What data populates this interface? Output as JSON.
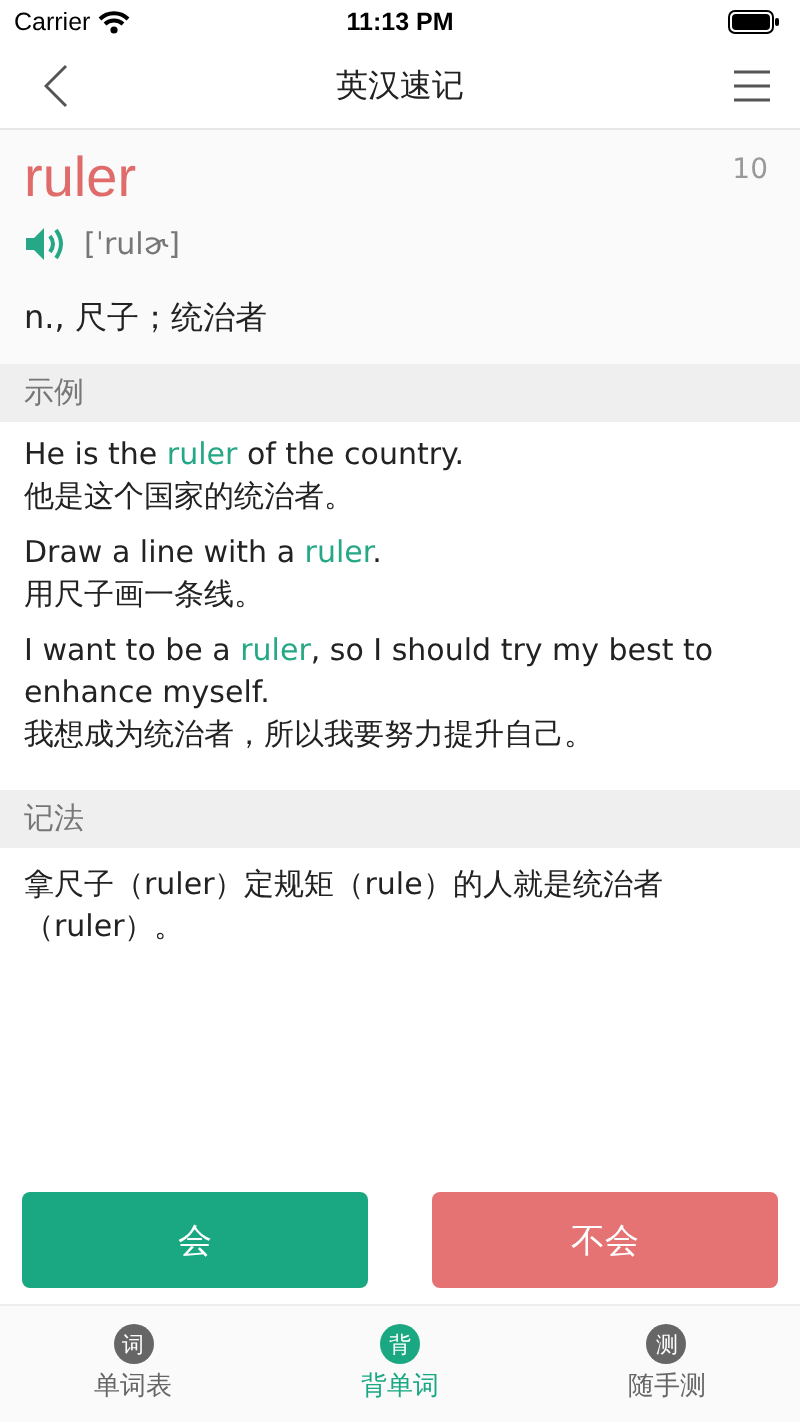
{
  "status_bar": {
    "carrier": "Carrier",
    "time": "11:13 PM"
  },
  "nav": {
    "title": "英汉速记"
  },
  "word": {
    "text": "ruler",
    "count": "10",
    "phonetic": "[ˈrulɚ]",
    "meaning": "n., 尺子；统治者"
  },
  "examples": {
    "heading": "示例",
    "items": [
      {
        "en": [
          {
            "text": "He is the ",
            "highlight": false
          },
          {
            "text": "ruler",
            "highlight": true
          },
          {
            "text": " of the country.",
            "highlight": false
          }
        ],
        "zh": "他是这个国家的统治者。"
      },
      {
        "en": [
          {
            "text": "Draw a line with a ",
            "highlight": false
          },
          {
            "text": "ruler",
            "highlight": true
          },
          {
            "text": ".",
            "highlight": false
          }
        ],
        "zh": "用尺子画一条线。"
      },
      {
        "en": [
          {
            "text": "I want to be a ",
            "highlight": false
          },
          {
            "text": "ruler",
            "highlight": true
          },
          {
            "text": ", so I should try my best to enhance myself.",
            "highlight": false
          }
        ],
        "zh": "我想成为统治者，所以我要努力提升自己。"
      }
    ]
  },
  "mnemonic": {
    "heading": "记法",
    "text": "拿尺子（ruler）定规矩（rule）的人就是统治者（ruler）。"
  },
  "buttons": [
    {
      "label": "会",
      "kind": "know"
    },
    {
      "label": "不会",
      "kind": "unknown"
    }
  ],
  "tabs": [
    {
      "icon": "词",
      "label": "单词表",
      "selected": false
    },
    {
      "icon": "背",
      "label": "背单词",
      "selected": true
    },
    {
      "icon": "测",
      "label": "随手测",
      "selected": false
    }
  ]
}
